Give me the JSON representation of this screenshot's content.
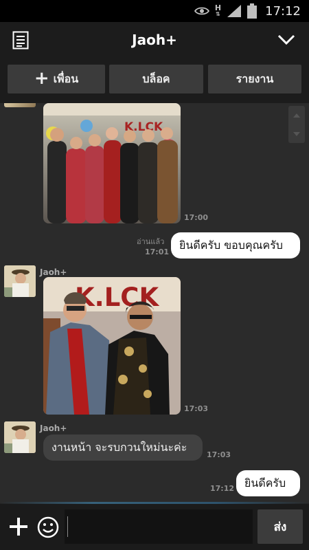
{
  "status_bar": {
    "network": "H",
    "time": "17:12",
    "icons": [
      "eye-icon",
      "network-h-icon",
      "signal-icon",
      "battery-icon"
    ]
  },
  "header": {
    "title": "Jaoh+",
    "left_icon": "notes-icon",
    "right_icon": "chevron-down-icon"
  },
  "actions": {
    "add_friend": "เพื่อน",
    "block": "บล็อค",
    "report": "รายงาน"
  },
  "messages": [
    {
      "type": "image",
      "direction": "in",
      "time": "17:00",
      "image_text": "K.LCK"
    },
    {
      "type": "text",
      "direction": "out",
      "read_label": "อ่านแล้ว",
      "time": "17:01",
      "text": "ยินดีครับ ขอบคุณครับ"
    },
    {
      "type": "image",
      "direction": "in",
      "sender": "Jaoh+",
      "time": "17:03",
      "image_text": "K.LCK"
    },
    {
      "type": "text",
      "direction": "in",
      "sender": "Jaoh+",
      "time": "17:03",
      "text": "งานหน้า จะรบกวนใหม่นะค่ะ"
    },
    {
      "type": "text",
      "direction": "out",
      "time": "17:12",
      "text": "ยินดีครับ"
    }
  ],
  "composer": {
    "placeholder": "",
    "send_label": "ส่ง",
    "plus_icon": "plus-icon",
    "emoji_icon": "emoji-icon"
  },
  "colors": {
    "status_bar": "#000000",
    "header": "#1c1c1c",
    "chat_background": "#2b2b2b",
    "outgoing_bubble": "#ffffff",
    "incoming_bubble": "#414141",
    "button": "#3b3b3b"
  }
}
